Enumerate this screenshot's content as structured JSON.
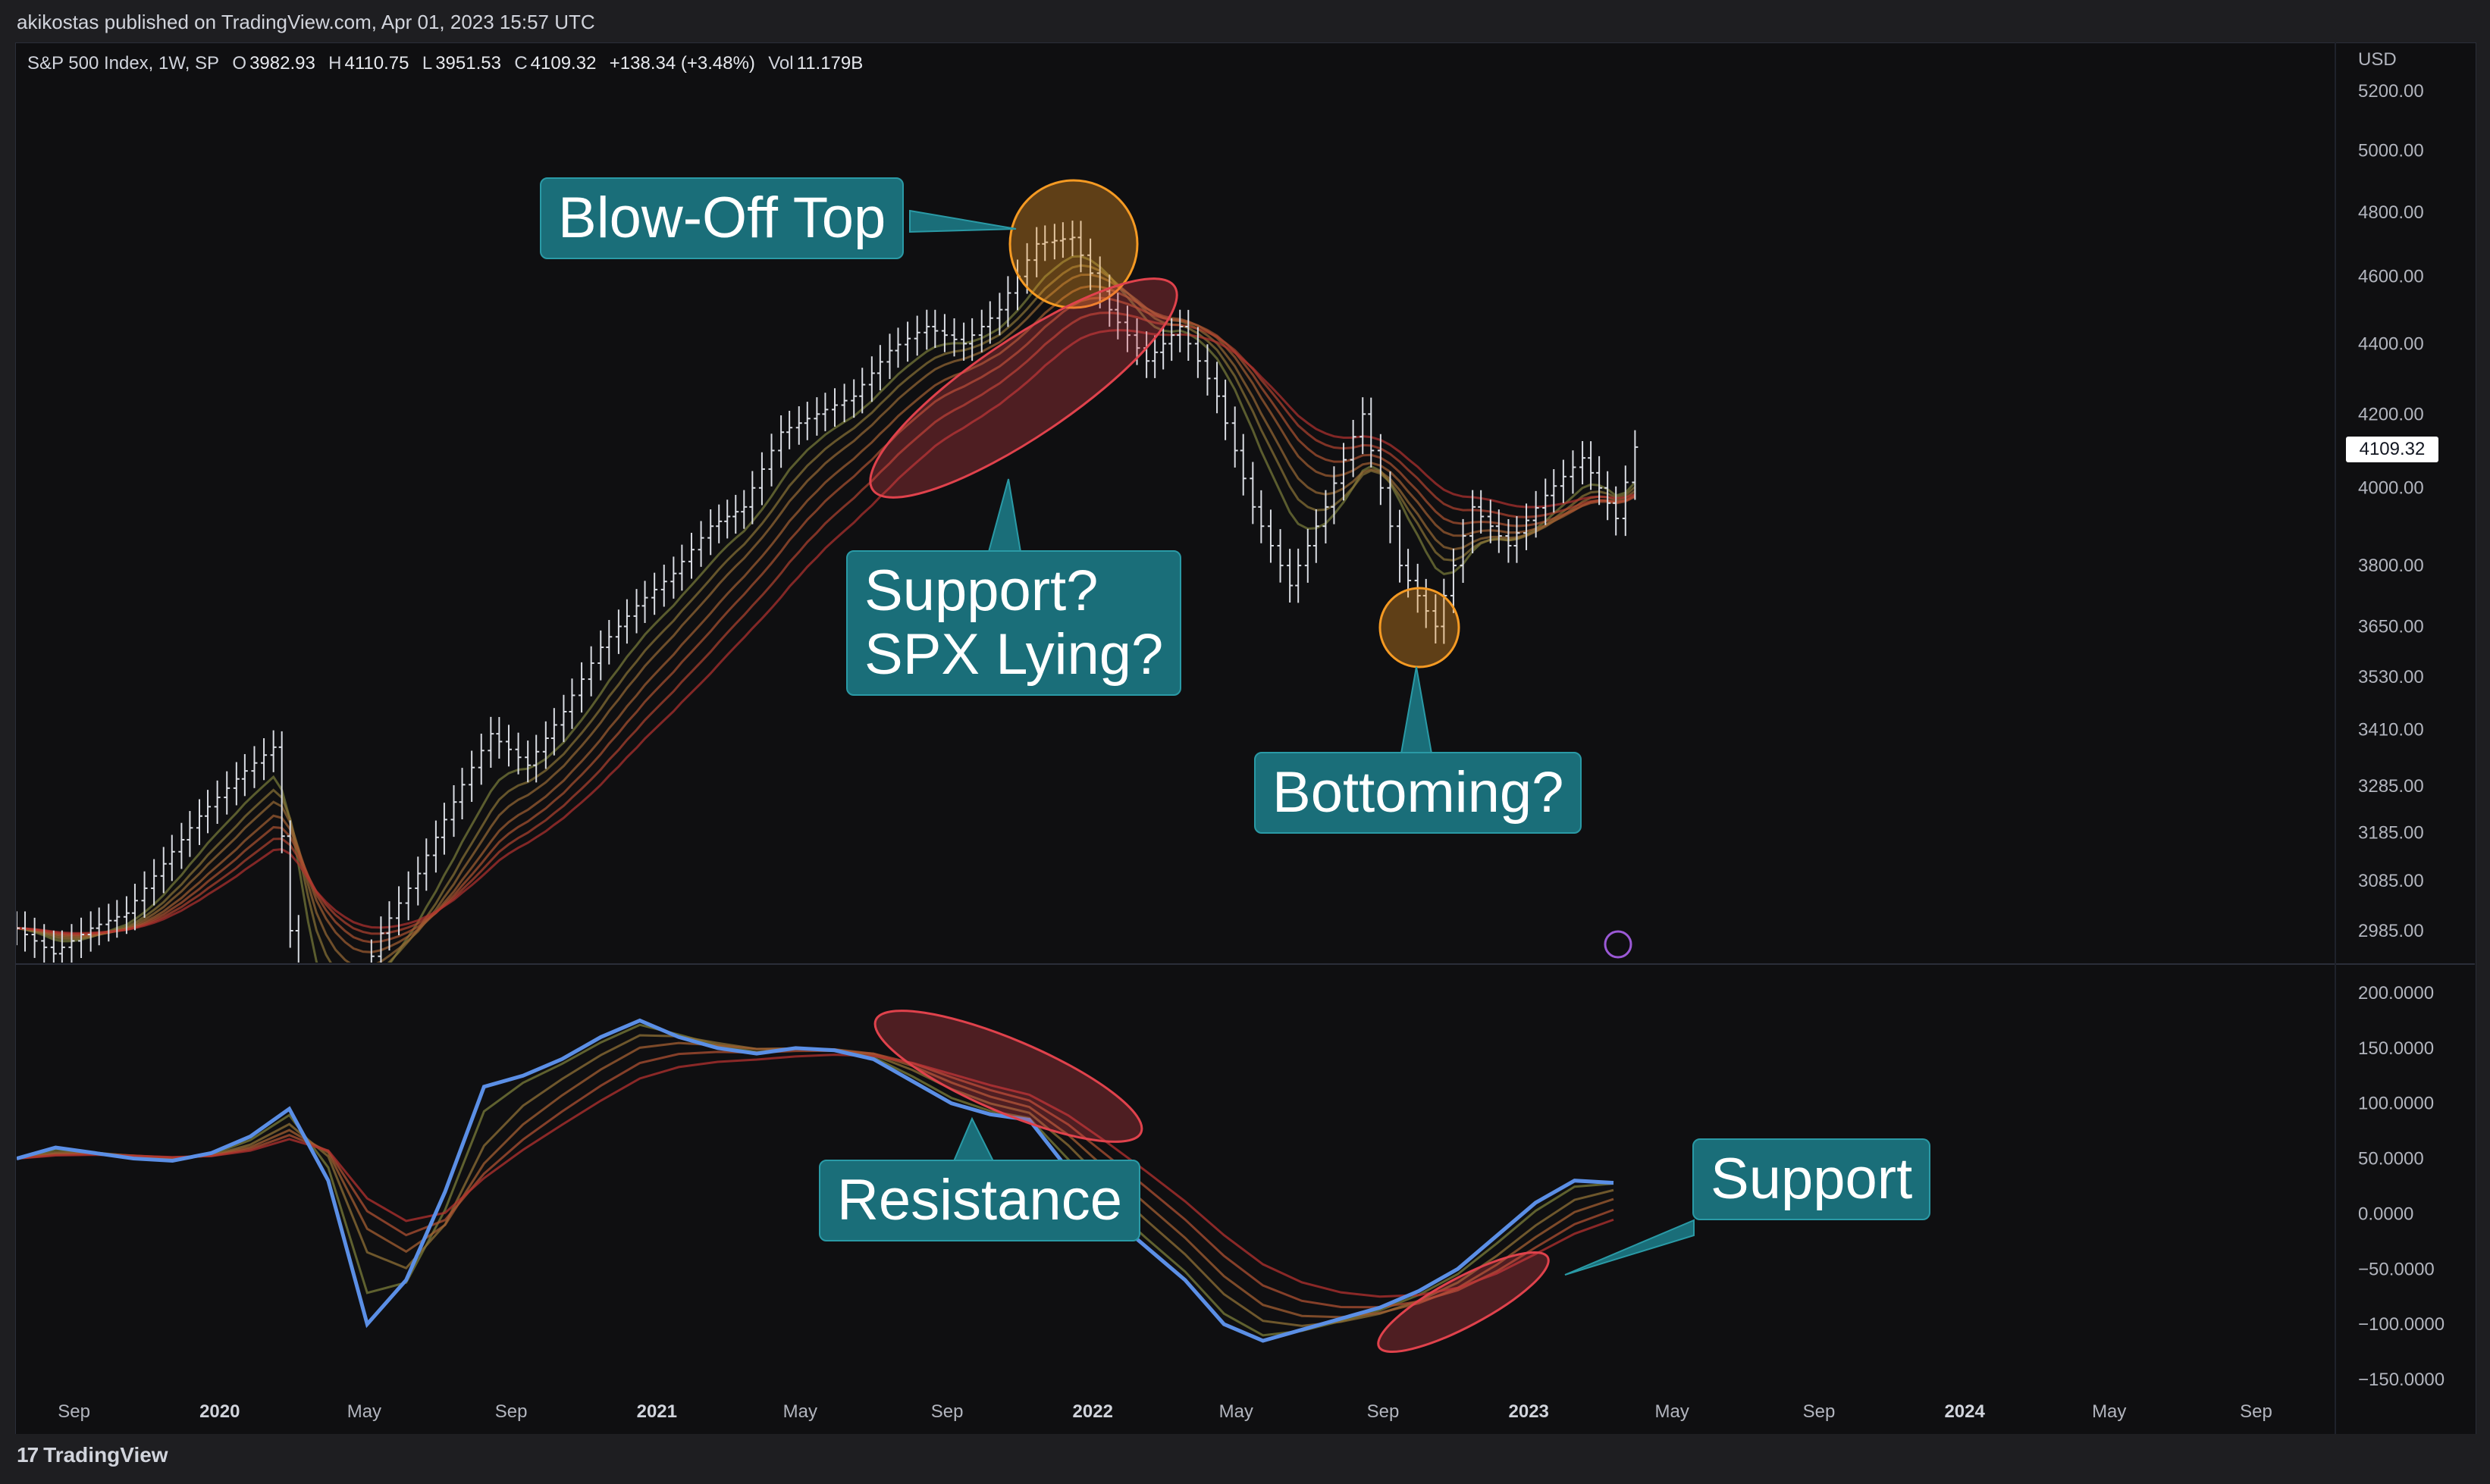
{
  "header": {
    "published_text": "akikostas published on TradingView.com, Apr 01, 2023 15:57 UTC"
  },
  "legend": {
    "symbol": "S&P 500 Index, 1W, SP",
    "open_label": "O",
    "open": "3982.93",
    "high_label": "H",
    "high": "4110.75",
    "low_label": "L",
    "low": "3951.53",
    "close_label": "C",
    "close": "4109.32",
    "change": "+138.34 (+3.48%)",
    "vol_label": "Vol",
    "vol": "11.179B"
  },
  "price_axis": {
    "currency": "USD",
    "ticks": [
      "5200.00",
      "5000.00",
      "4800.00",
      "4600.00",
      "4400.00",
      "4200.00",
      "4000.00",
      "3800.00",
      "3650.00",
      "3530.00",
      "3410.00",
      "3285.00",
      "3185.00",
      "3085.00",
      "2985.00"
    ],
    "last_price": "4109.32"
  },
  "osc_axis": {
    "ticks": [
      "200.0000",
      "150.0000",
      "100.0000",
      "50.0000",
      "0.0000",
      "−50.0000",
      "−100.0000",
      "−150.0000"
    ]
  },
  "time_axis": {
    "labels": [
      "Sep",
      "2020",
      "May",
      "Sep",
      "2021",
      "May",
      "Sep",
      "2022",
      "May",
      "Sep",
      "2023",
      "May",
      "Sep",
      "2024",
      "May",
      "Sep"
    ]
  },
  "annotations": {
    "blow_off_top": "Blow-Off Top",
    "support_spx": "Support?\nSPX Lying?",
    "bottoming": "Bottoming?",
    "resistance": "Resistance",
    "support": "Support"
  },
  "footer": {
    "brand": "TradingView",
    "logo_mark": "17"
  },
  "colors": {
    "background": "#0f0f11",
    "callout_fill": "#1a6e79",
    "callout_border": "#2a9aa6",
    "ellipse_red": "#e0424c",
    "circle_orange": "#f59a23",
    "oscillator_line": "#5b8fe6",
    "price_bars": "#d9dce3",
    "ribbon_start": "#7b7e3a",
    "ribbon_end": "#b4322f"
  },
  "chart_data": [
    {
      "type": "line",
      "title": "S&P 500 Index, 1W, SP",
      "scale": "log",
      "ylim": [
        2950,
        5300
      ],
      "x_range": [
        "2019-07-15",
        "2024-10-31"
      ],
      "price_series_step_weeks": 4,
      "price_series": [
        {
          "date": "2019-07-15",
          "close": 2990
        },
        {
          "date": "2019-08-15",
          "close": 2940
        },
        {
          "date": "2019-09-15",
          "close": 2990
        },
        {
          "date": "2019-10-15",
          "close": 3020
        },
        {
          "date": "2019-11-15",
          "close": 3120
        },
        {
          "date": "2019-12-15",
          "close": 3220
        },
        {
          "date": "2020-01-15",
          "close": 3300
        },
        {
          "date": "2020-02-15",
          "close": 3370
        },
        {
          "date": "2020-03-15",
          "close": 2600
        },
        {
          "date": "2020-04-15",
          "close": 2800
        },
        {
          "date": "2020-05-15",
          "close": 2980
        },
        {
          "date": "2020-06-15",
          "close": 3100
        },
        {
          "date": "2020-07-15",
          "close": 3250
        },
        {
          "date": "2020-08-15",
          "close": 3400
        },
        {
          "date": "2020-09-15",
          "close": 3330
        },
        {
          "date": "2020-10-15",
          "close": 3450
        },
        {
          "date": "2020-11-15",
          "close": 3600
        },
        {
          "date": "2020-12-15",
          "close": 3700
        },
        {
          "date": "2021-01-15",
          "close": 3780
        },
        {
          "date": "2021-02-15",
          "close": 3900
        },
        {
          "date": "2021-03-15",
          "close": 3950
        },
        {
          "date": "2021-04-15",
          "close": 4150
        },
        {
          "date": "2021-05-15",
          "close": 4200
        },
        {
          "date": "2021-06-15",
          "close": 4250
        },
        {
          "date": "2021-07-15",
          "close": 4380
        },
        {
          "date": "2021-08-15",
          "close": 4450
        },
        {
          "date": "2021-09-15",
          "close": 4400
        },
        {
          "date": "2021-10-15",
          "close": 4500
        },
        {
          "date": "2021-11-15",
          "close": 4700
        },
        {
          "date": "2021-12-15",
          "close": 4720
        },
        {
          "date": "2022-01-15",
          "close": 4500
        },
        {
          "date": "2022-02-15",
          "close": 4350
        },
        {
          "date": "2022-03-15",
          "close": 4450
        },
        {
          "date": "2022-04-15",
          "close": 4250
        },
        {
          "date": "2022-05-15",
          "close": 3950
        },
        {
          "date": "2022-06-15",
          "close": 3750
        },
        {
          "date": "2022-07-15",
          "close": 3950
        },
        {
          "date": "2022-08-15",
          "close": 4200
        },
        {
          "date": "2022-09-15",
          "close": 3800
        },
        {
          "date": "2022-10-15",
          "close": 3650
        },
        {
          "date": "2022-11-15",
          "close": 3950
        },
        {
          "date": "2022-12-15",
          "close": 3850
        },
        {
          "date": "2023-01-15",
          "close": 3980
        },
        {
          "date": "2023-02-15",
          "close": 4080
        },
        {
          "date": "2023-03-15",
          "close": 3920
        },
        {
          "date": "2023-03-31",
          "close": 4109.32
        }
      ]
    },
    {
      "type": "line",
      "ylim": [
        -170,
        210
      ],
      "series": [
        {
          "step_weeks": 4,
          "values": [
            50,
            60,
            55,
            50,
            48,
            55,
            70,
            95,
            30,
            -100,
            -60,
            20,
            115,
            125,
            140,
            160,
            175,
            160,
            150,
            145,
            150,
            148,
            140,
            120,
            100,
            90,
            85,
            40,
            0,
            -30,
            -60,
            -100,
            -115,
            -105,
            -95,
            -85,
            -70,
            -50,
            -20,
            10,
            30,
            28
          ]
        }
      ]
    }
  ]
}
